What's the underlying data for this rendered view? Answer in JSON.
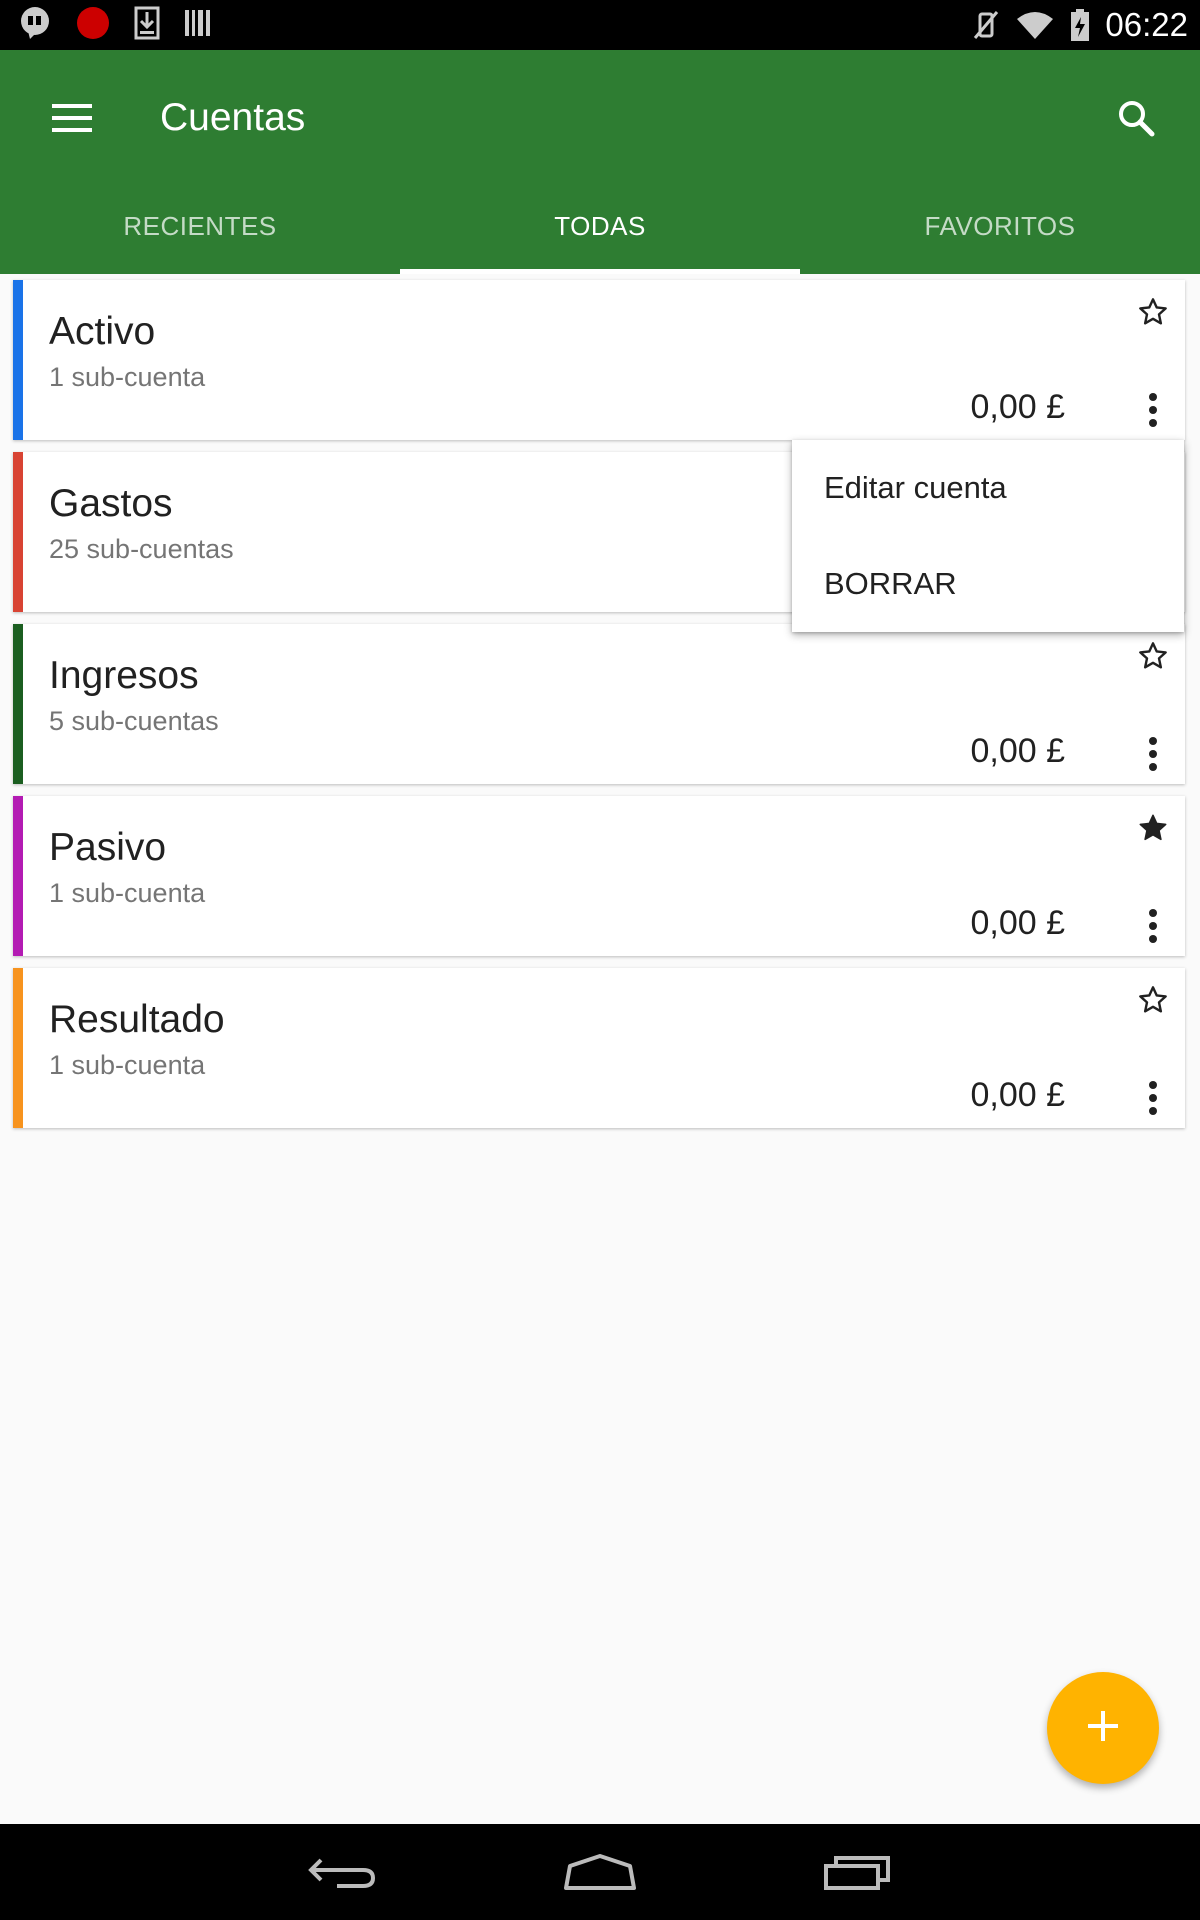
{
  "status_bar": {
    "time": "06:22",
    "left_icons": [
      "hangouts-icon",
      "record-icon",
      "download-icon",
      "barcode-icon"
    ],
    "right_icons": [
      "vibrate-off-icon",
      "wifi-icon",
      "battery-charging-icon"
    ]
  },
  "toolbar": {
    "title": "Cuentas",
    "menu_icon": "hamburger-menu-icon",
    "search_icon": "search-icon",
    "color": "#2e7d32"
  },
  "tabs": [
    {
      "label": "RECIENTES",
      "active": false
    },
    {
      "label": "TODAS",
      "active": true
    },
    {
      "label": "FAVORITOS",
      "active": false
    }
  ],
  "accounts": [
    {
      "name": "Activo",
      "subaccounts": "1 sub-cuenta",
      "balance": "0,00 £",
      "color": "#1a73e8",
      "favorite": false
    },
    {
      "name": "Gastos",
      "subaccounts": "25 sub-cuentas",
      "balance": "",
      "color": "#d84333",
      "favorite": false
    },
    {
      "name": "Ingresos",
      "subaccounts": "5 sub-cuentas",
      "balance": "0,00 £",
      "color": "#1b5e20",
      "favorite": false
    },
    {
      "name": "Pasivo",
      "subaccounts": "1 sub-cuenta",
      "balance": "0,00 £",
      "color": "#b31bb3",
      "favorite": true
    },
    {
      "name": "Resultado",
      "subaccounts": "1 sub-cuenta",
      "balance": "0,00 £",
      "color": "#f7931e",
      "favorite": false
    }
  ],
  "popup_menu": {
    "items": [
      "Editar cuenta",
      "BORRAR"
    ]
  },
  "fab": {
    "icon": "plus-icon",
    "color": "#ffb300"
  },
  "nav_bar": {
    "icons": [
      "back-icon",
      "home-icon",
      "recent-apps-icon"
    ]
  }
}
